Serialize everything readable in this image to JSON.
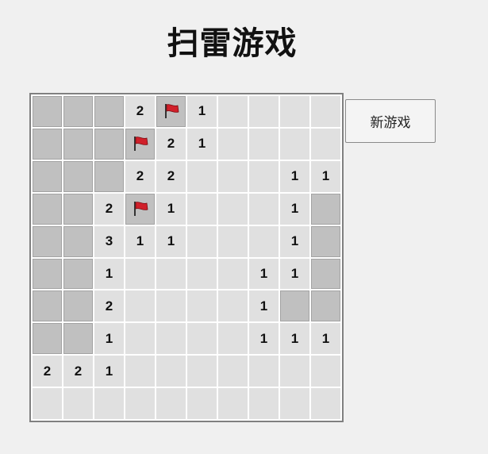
{
  "title": "扫雷游戏",
  "new_game_label": "新游戏",
  "colors": {
    "hidden_cell": "#c0c0c0",
    "open_cell": "#e0e0e0",
    "flag": "#d0202a",
    "board_border": "#808080"
  },
  "board": {
    "rows": 10,
    "cols": 10,
    "cells": [
      [
        "H",
        "H",
        "H",
        "2",
        "F",
        "1",
        "",
        "",
        "",
        ""
      ],
      [
        "H",
        "H",
        "H",
        "F",
        "2",
        "1",
        "",
        "",
        "",
        ""
      ],
      [
        "H",
        "H",
        "H",
        "2",
        "2",
        "",
        "",
        "",
        "1",
        "1"
      ],
      [
        "H",
        "H",
        "2",
        "F",
        "1",
        "",
        "",
        "",
        "1",
        "H"
      ],
      [
        "H",
        "H",
        "3",
        "1",
        "1",
        "",
        "",
        "",
        "1",
        "H"
      ],
      [
        "H",
        "H",
        "1",
        "",
        "",
        "",
        "",
        "1",
        "1",
        "H"
      ],
      [
        "H",
        "H",
        "2",
        "",
        "",
        "",
        "",
        "1",
        "H",
        "H"
      ],
      [
        "H",
        "H",
        "1",
        "",
        "",
        "",
        "",
        "1",
        "1",
        "1"
      ],
      [
        "2",
        "2",
        "1",
        "",
        "",
        "",
        "",
        "",
        "",
        ""
      ],
      [
        "",
        "",
        "",
        "",
        "",
        "",
        "",
        "",
        "",
        ""
      ]
    ]
  }
}
